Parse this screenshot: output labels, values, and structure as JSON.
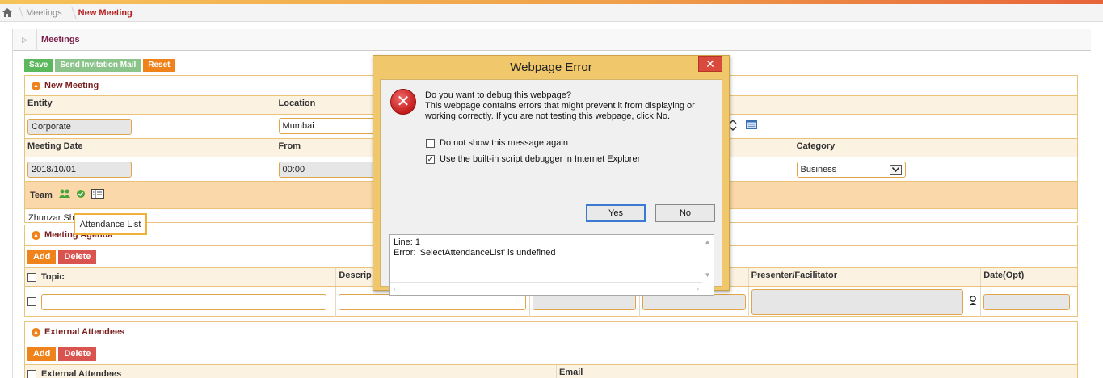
{
  "breadcrumb": {
    "home_icon": "home-icon",
    "items": [
      "Meetings"
    ],
    "current": "New Meeting"
  },
  "page": {
    "title": "Meetings"
  },
  "toolbar": {
    "save": "Save",
    "send": "Send Invitation Mail",
    "reset": "Reset"
  },
  "new_meeting": {
    "title": "New Meeting",
    "entity_label": "Entity",
    "entity_value": "Corporate",
    "location_label": "Location",
    "location_value": "Mumbai",
    "date_label": "Meeting Date",
    "date_value": "2018/10/01",
    "from_label": "From",
    "from_value": "00:00",
    "category_label": "Category",
    "category_value": "Business",
    "team_label": "Team",
    "team_member": "Zhunzar Sh"
  },
  "tooltip": {
    "text": "Attendance List"
  },
  "agenda": {
    "title": "Meeting Agenda",
    "add": "Add",
    "delete": "Delete",
    "columns": [
      "Topic",
      "Descrip",
      "Presenter/Facilitator",
      "Date(Opt)"
    ]
  },
  "external": {
    "title": "External Attendees",
    "add": "Add",
    "delete": "Delete",
    "columns": [
      "External Attendees",
      "Email"
    ]
  },
  "dialog": {
    "title": "Webpage Error",
    "close": "✕",
    "question": "Do you want to debug this webpage?",
    "message": "This webpage contains errors that might prevent it from displaying or working correctly. If you are not testing this webpage, click No.",
    "opt1": "Do not show this message again",
    "opt1_checked": false,
    "opt2": "Use the built-in script debugger in Internet Explorer",
    "opt2_checked": true,
    "yes": "Yes",
    "no": "No",
    "detail_line1": "Line: 1",
    "detail_line2": "Error: 'SelectAttendanceList' is undefined"
  }
}
